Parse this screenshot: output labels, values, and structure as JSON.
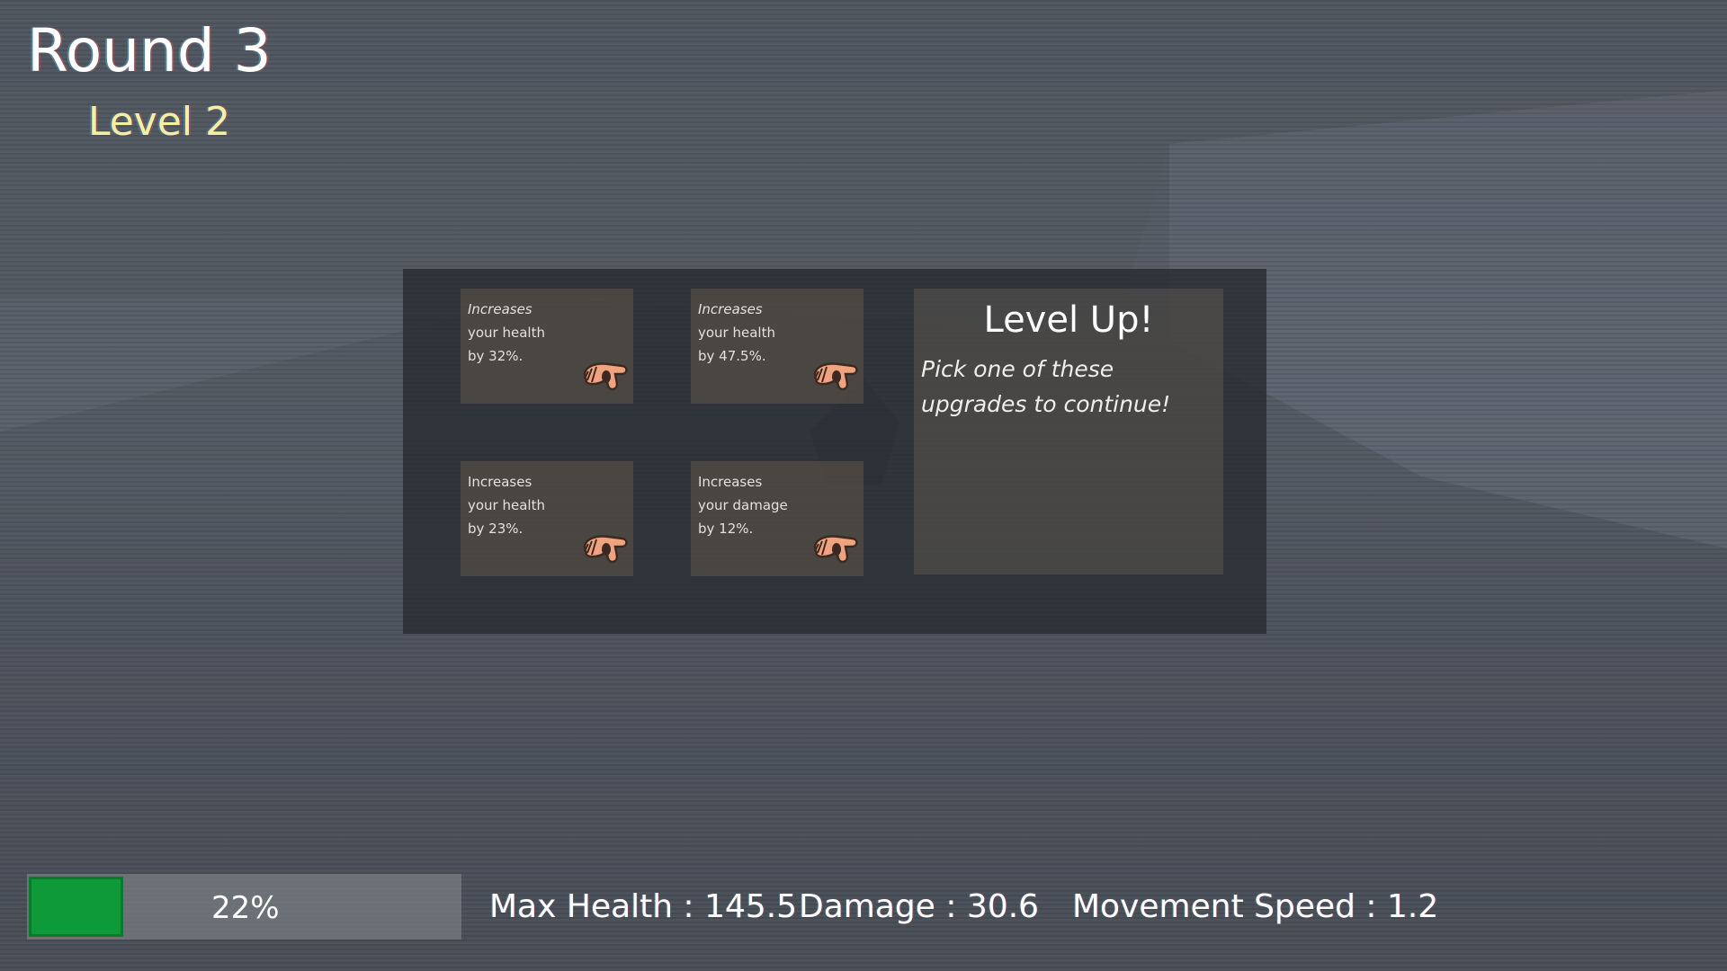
{
  "hud": {
    "round": "Round 3",
    "level": "Level 2"
  },
  "level_up": {
    "title": "Level Up!",
    "subtitle": "Pick one of these upgrades to continue!",
    "cards": [
      {
        "line1": "Increases",
        "line2": "your health",
        "line3": "by 32%.",
        "icon": "hand-icon"
      },
      {
        "line1": "Increases",
        "line2": "your health",
        "line3": "by 47.5%.",
        "icon": "hand-icon"
      },
      {
        "line1": "Increases",
        "line2": "your health",
        "line3": "by 23%.",
        "icon": "hand-icon"
      },
      {
        "line1": "Increases",
        "line2": "your damage",
        "line3": "by 12%.",
        "icon": "hand-icon"
      }
    ]
  },
  "xp": {
    "label": "22%",
    "progress": 0.22
  },
  "stats": {
    "max_health": "Max Health : 145.5",
    "damage": "Damage : 30.6",
    "movement_speed": "Movement Speed : 1.2"
  },
  "colors": {
    "xp_fill": "#0f9a3a",
    "level_text": "#f3f0a6"
  }
}
